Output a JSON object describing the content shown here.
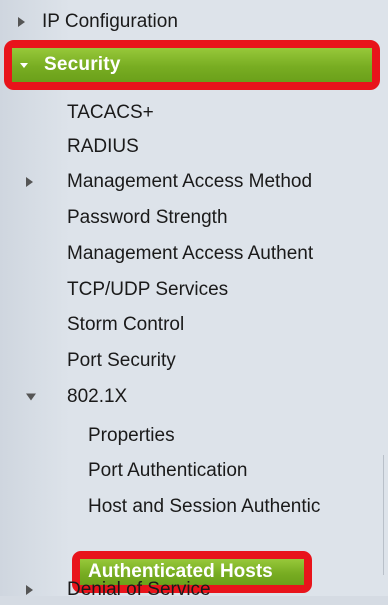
{
  "nav": {
    "ip_configuration": "IP Configuration",
    "security": "Security",
    "security_items": [
      "TACACS+",
      "RADIUS",
      "Management Access Method",
      "Password Strength",
      "Management Access Authent",
      "TCP/UDP Services",
      "Storm Control",
      "Port Security",
      "802.1X"
    ],
    "dot1x_items": [
      "Properties",
      "Port Authentication",
      "Host and Session Authentic",
      "Authenticated Hosts"
    ],
    "denial_of_service": "Denial of Service"
  },
  "colors": {
    "highlight_border": "#e8141b",
    "selected_bg": "#78ad22",
    "panel_bg": "#dde3ea"
  },
  "icons": {
    "collapsed": "arrow-right-icon",
    "expanded": "arrow-down-icon"
  }
}
